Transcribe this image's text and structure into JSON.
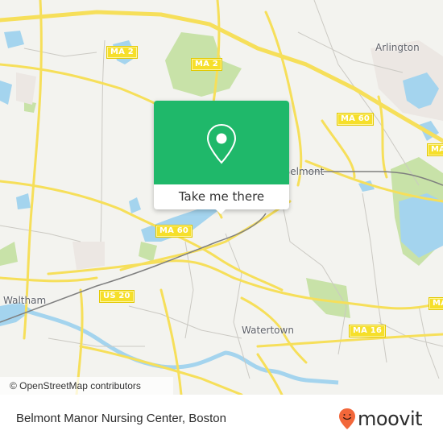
{
  "map": {
    "route_shields": [
      {
        "label": "MA 2",
        "id": "ma2-west"
      },
      {
        "label": "MA 2",
        "id": "ma2-center"
      },
      {
        "label": "MA 60",
        "id": "ma60-east"
      },
      {
        "label": "MA 60",
        "id": "ma60-center"
      },
      {
        "label": "US 20",
        "id": "us20"
      },
      {
        "label": "MA 16",
        "id": "ma16"
      },
      {
        "label": "MA",
        "id": "ma-east-upper"
      },
      {
        "label": "MA",
        "id": "ma-east-lower"
      }
    ],
    "places": [
      {
        "label": "Arlington"
      },
      {
        "label": "Belmont"
      },
      {
        "label": "Waltham"
      },
      {
        "label": "Watertown"
      }
    ],
    "attribution": "© OpenStreetMap contributors",
    "colors": {
      "land": "#f3f3ef",
      "water": "#a4d4ee",
      "park": "#c5e0a5",
      "road_major": "#f6df5a",
      "road_minor": "#c8c6c0",
      "rail": "#7f7f7f"
    }
  },
  "popup": {
    "icon": "map-pin-icon",
    "button_label": "Take me there",
    "accent_color": "#1fb86a"
  },
  "footer": {
    "title": "Belmont Manor Nursing Center, Boston",
    "brand": "moovit",
    "brand_icon": "moovit-smile-pin-icon",
    "brand_color": "#f2673a"
  }
}
